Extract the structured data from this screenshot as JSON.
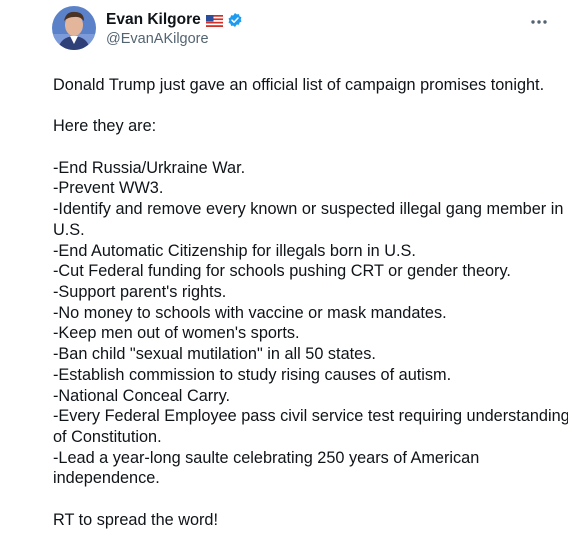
{
  "author": {
    "display_name": "Evan Kilgore",
    "handle": "@EvanAKilgore",
    "flag_icon": "us-flag-icon",
    "verified_icon": "verified-badge-icon",
    "verified_color": "#1d9bf0"
  },
  "menu": {
    "icon": "more-horizontal-icon"
  },
  "tweet": {
    "intro": "Donald Trump just gave an official list of campaign promises tonight.",
    "lead": "Here they are:",
    "lines": [
      "-End Russia/Urkraine War.",
      "-Prevent WW3.",
      "-Identify and remove every known or suspected illegal gang member in",
      "U.S.",
      "-End Automatic Citizenship for illegals born in U.S.",
      "-Cut Federal funding for schools pushing CRT or gender theory.",
      "-Support parent's rights.",
      "-No money to schools with vaccine or mask mandates.",
      "-Keep men out of women's sports.",
      "-Ban child \"sexual mutilation\" in all 50 states.",
      "-Establish commission to study rising causes of autism.",
      "-National Conceal Carry.",
      "-Every Federal Employee pass civil service test requiring understanding",
      "of Constitution.",
      "-Lead a year-long saulte celebrating 250 years of American",
      "independence."
    ],
    "outro": "RT to spread the word!"
  }
}
